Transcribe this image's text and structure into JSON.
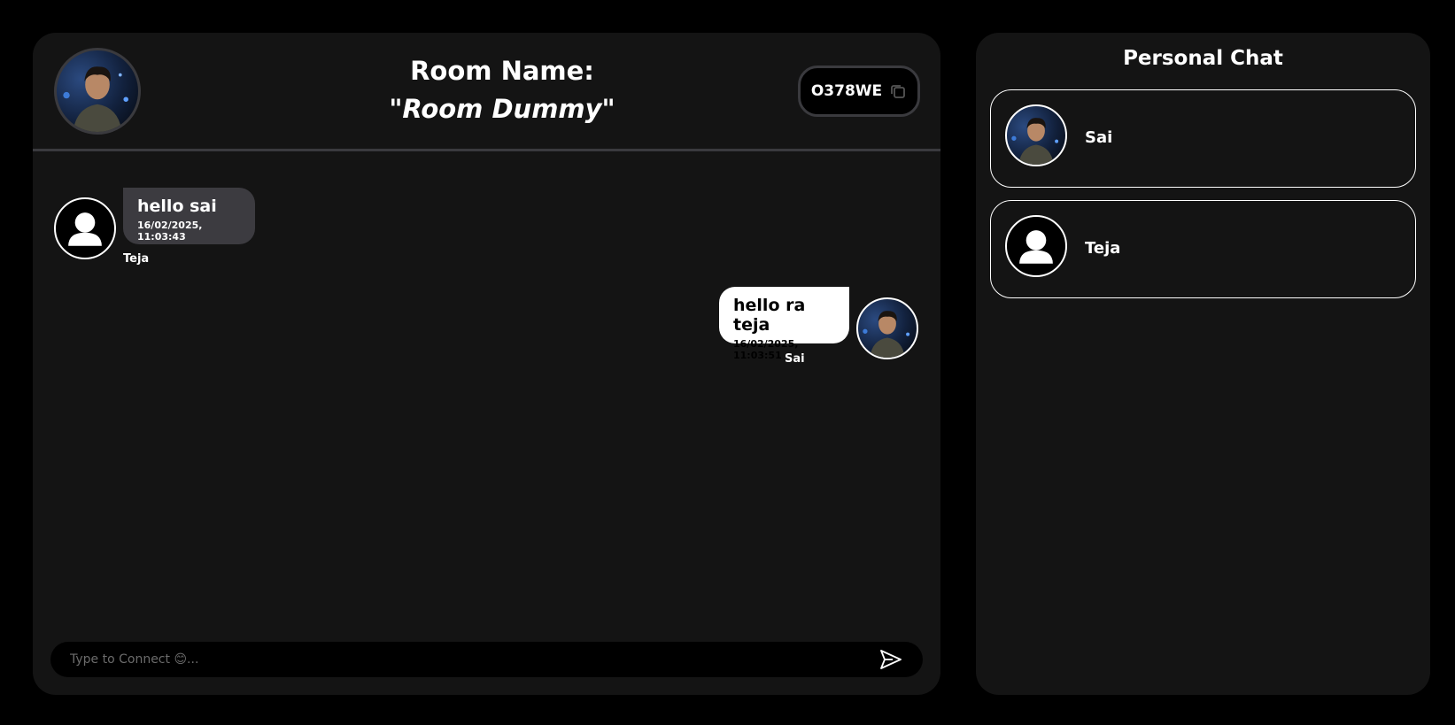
{
  "header": {
    "room_label": "Room Name:",
    "room_name": "\"Room Dummy\"",
    "room_code": "O378WE"
  },
  "messages": [
    {
      "text": "hello sai",
      "timestamp": "16/02/2025, 11:03:43",
      "sender": "Teja",
      "side": "left",
      "avatar": "default-user-icon"
    },
    {
      "text": "hello ra teja",
      "timestamp": "16/02/2025, 11:03:51",
      "sender": "Sai",
      "side": "right",
      "avatar": "profile-photo"
    }
  ],
  "composer": {
    "placeholder": "Type to Connect 😊..."
  },
  "sidebar": {
    "title": "Personal Chat",
    "contacts": [
      {
        "name": "Sai",
        "avatar": "profile-photo"
      },
      {
        "name": "Teja",
        "avatar": "default-user-icon"
      }
    ]
  },
  "colors": {
    "background": "#000000",
    "panel": "#141414",
    "received_bubble": "#3c3b40",
    "sent_bubble": "#ffffff",
    "divider": "#3a3a3e"
  }
}
